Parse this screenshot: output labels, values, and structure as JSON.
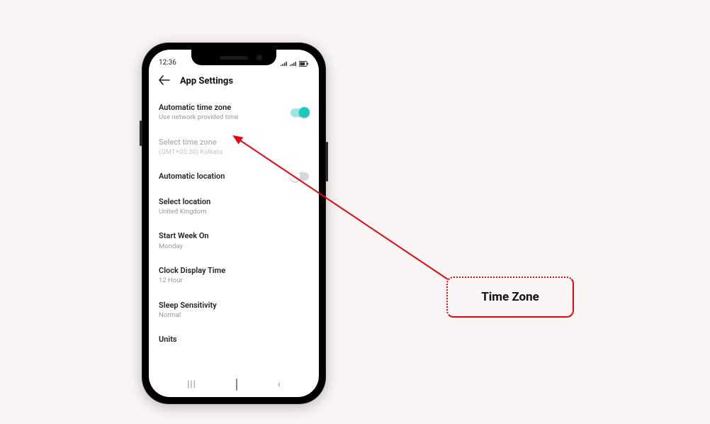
{
  "statusbar": {
    "time": "12:36"
  },
  "appbar": {
    "title": "App Settings"
  },
  "settings": {
    "auto_tz": {
      "label": "Automatic time zone",
      "sub": "Use network provided time",
      "toggle_on": true
    },
    "select_tz": {
      "label": "Select time zone",
      "sub": "(GMT+05:30) Kolkata"
    },
    "auto_loc": {
      "label": "Automatic location",
      "toggle_on": false
    },
    "select_loc": {
      "label": "Select location",
      "sub": "United Kingdom"
    },
    "start_week": {
      "label": "Start Week On",
      "sub": "Monday"
    },
    "clock_disp": {
      "label": "Clock Display Time",
      "sub": "12 Hour"
    },
    "sleep_sens": {
      "label": "Sleep Sensitivity",
      "sub": "Normal"
    },
    "units": {
      "label": "Units"
    }
  },
  "callout": {
    "text": "Time Zone"
  }
}
